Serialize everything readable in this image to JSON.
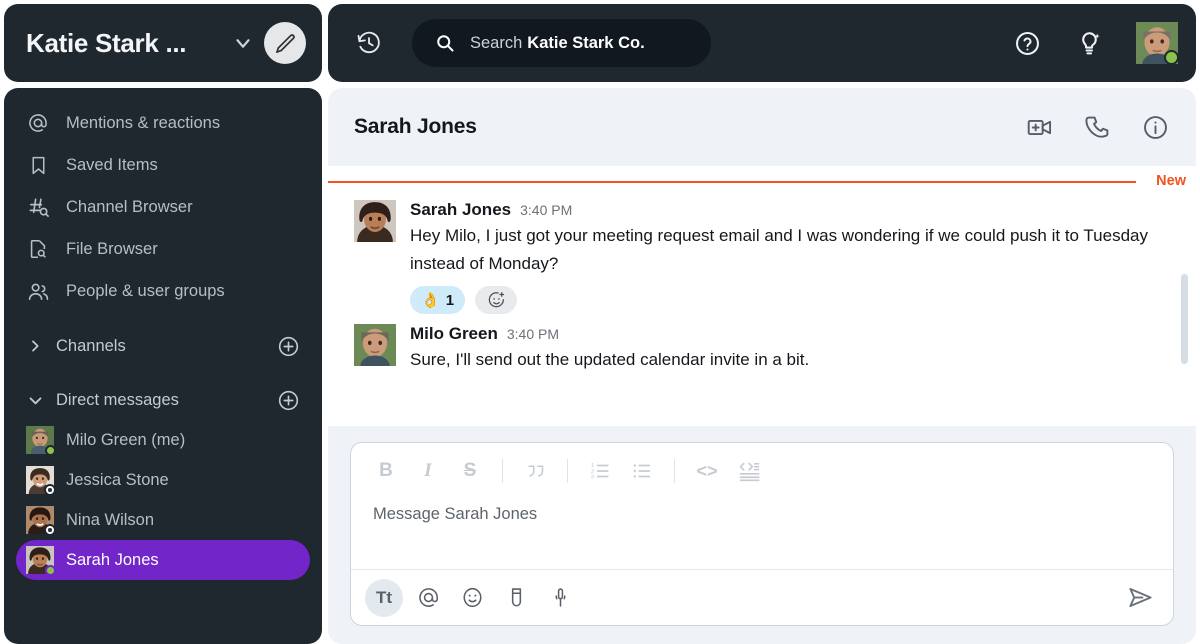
{
  "workspace": {
    "title": "Katie Stark ...",
    "chevron_icon": "chevron-down-icon",
    "compose_icon": "pencil-compose-icon"
  },
  "sidebar": {
    "nav_items": [
      {
        "icon": "at-mention-icon",
        "label": "Mentions & reactions"
      },
      {
        "icon": "bookmark-icon",
        "label": "Saved Items"
      },
      {
        "icon": "channel-search-icon",
        "label": "Channel Browser"
      },
      {
        "icon": "file-search-icon",
        "label": "File Browser"
      },
      {
        "icon": "people-group-icon",
        "label": "People & user groups"
      }
    ],
    "sections": [
      {
        "label": "Channels",
        "expanded": false,
        "add_icon": "plus-circle-icon"
      },
      {
        "label": "Direct messages",
        "expanded": true,
        "add_icon": "plus-circle-icon"
      }
    ],
    "dms": [
      {
        "name": "Milo Green (me)",
        "status": "online",
        "active": false
      },
      {
        "name": "Jessica Stone",
        "status": "away",
        "active": false
      },
      {
        "name": "Nina Wilson",
        "status": "away",
        "active": false
      },
      {
        "name": "Sarah Jones",
        "status": "online",
        "active": true
      }
    ],
    "active_color": "#7226c9"
  },
  "topbar": {
    "history_icon": "clock-history-icon",
    "search": {
      "icon": "search-icon",
      "label": "Search",
      "scope": "Katie Stark Co.",
      "placeholder": "Search Katie Stark Co."
    },
    "help_icon": "question-circle-icon",
    "ideas_icon": "lightbulb-sparkle-icon",
    "avatar_status": "online"
  },
  "conversation": {
    "title": "Sarah Jones",
    "actions": [
      {
        "icon": "video-call-icon",
        "label": "Start video call"
      },
      {
        "icon": "phone-call-icon",
        "label": "Start call"
      },
      {
        "icon": "info-circle-icon",
        "label": "Conversation details"
      }
    ],
    "new_divider_label": "New",
    "new_divider_color": "#f4511e",
    "messages": [
      {
        "author": "Sarah Jones",
        "time": "3:40 PM",
        "text": "Hey Milo, I just got your meeting request email and I was wondering if we could push it to Tuesday instead of Monday?",
        "avatar_status": "online",
        "reactions": [
          {
            "emoji": "👌",
            "count": "1"
          }
        ],
        "add_reaction_icon": "add-reaction-icon"
      },
      {
        "author": "Milo Green",
        "time": "3:40 PM",
        "text": "Sure, I'll send out the updated calendar invite in a bit.",
        "avatar_status": "online",
        "reactions": []
      }
    ]
  },
  "composer": {
    "placeholder": "Message Sarah Jones",
    "value": "",
    "format_buttons": [
      {
        "icon": "bold-icon",
        "label": "B"
      },
      {
        "icon": "italic-icon",
        "label": "I"
      },
      {
        "icon": "strikethrough-icon",
        "label": "S"
      },
      {
        "icon": "blockquote-icon",
        "label": "””"
      },
      {
        "icon": "ordered-list-icon",
        "label": ""
      },
      {
        "icon": "bulleted-list-icon",
        "label": ""
      },
      {
        "icon": "inline-code-icon",
        "label": "<>"
      },
      {
        "icon": "code-block-icon",
        "label": ""
      }
    ],
    "action_buttons": [
      {
        "icon": "text-format-icon",
        "label": "Tt",
        "active": true
      },
      {
        "icon": "at-mention-icon",
        "label": "@",
        "active": false
      },
      {
        "icon": "emoji-icon",
        "label": "",
        "active": false
      },
      {
        "icon": "attachment-clip-icon",
        "label": "",
        "active": false
      },
      {
        "icon": "microphone-icon",
        "label": "",
        "active": false
      }
    ],
    "send_icon": "send-paper-plane-icon"
  }
}
